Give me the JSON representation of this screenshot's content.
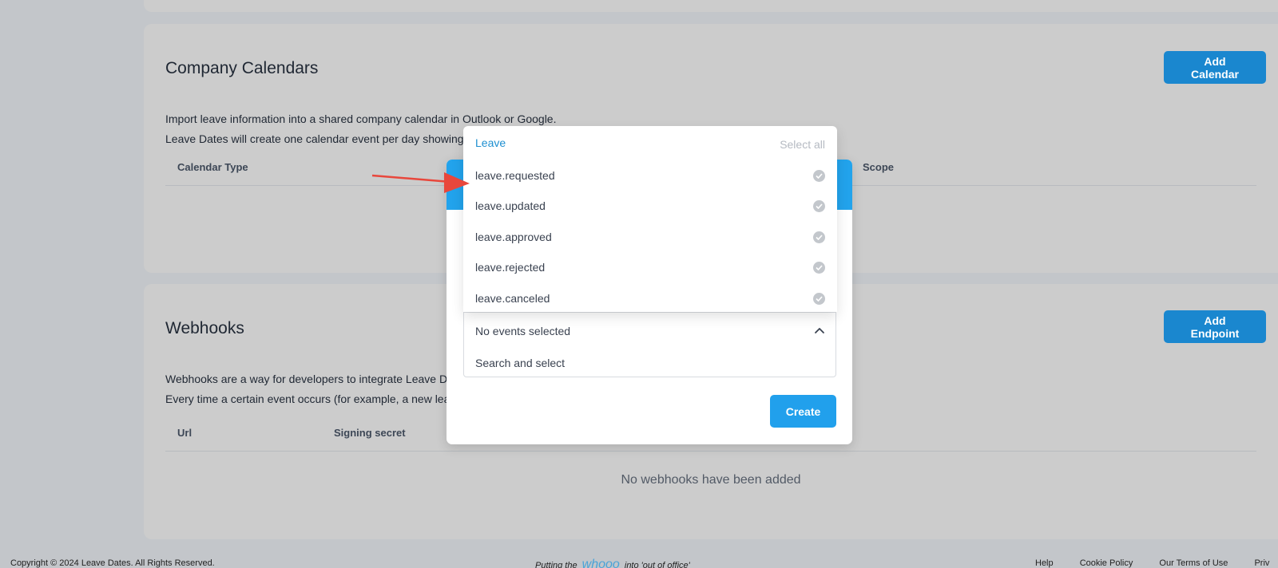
{
  "calendars": {
    "title": "Company Calendars",
    "add_button": "Add Calendar",
    "desc_line1": "Import leave information into a shared company calendar in Outlook or Google.",
    "desc_line2": "Leave Dates will create one calendar event per day showing w",
    "col_calendar_type": "Calendar Type",
    "col_scope": "Scope"
  },
  "webhooks": {
    "title": "Webhooks",
    "add_button": "Add Endpoint",
    "desc_line1": "Webhooks are a way for developers to integrate Leave Dat",
    "desc_line2": "Every time a certain event occurs (for example, a new leave",
    "col_url": "Url",
    "col_signing_secret": "Signing secret",
    "empty_message": "No webhooks have been added"
  },
  "dropdown": {
    "group_label": "Leave",
    "select_all": "Select all",
    "items": [
      {
        "label": "leave.requested"
      },
      {
        "label": "leave.updated"
      },
      {
        "label": "leave.approved"
      },
      {
        "label": "leave.rejected"
      },
      {
        "label": "leave.canceled"
      }
    ]
  },
  "modal": {
    "select_value": "No events selected",
    "search_placeholder": "Search and select",
    "create_button": "Create"
  },
  "footer": {
    "copyright": "Copyright © 2024 Leave Dates. All Rights Reserved.",
    "tagline_pre": "Putting the",
    "tagline_brand": "whooo",
    "tagline_post": "into 'out of office'",
    "links": [
      "Help",
      "Cookie Policy",
      "Our Terms of Use",
      "Priv"
    ]
  },
  "colors": {
    "primary": "#1a87cf",
    "modal_accent": "#22a3ec",
    "arrow": "#e8473c"
  }
}
